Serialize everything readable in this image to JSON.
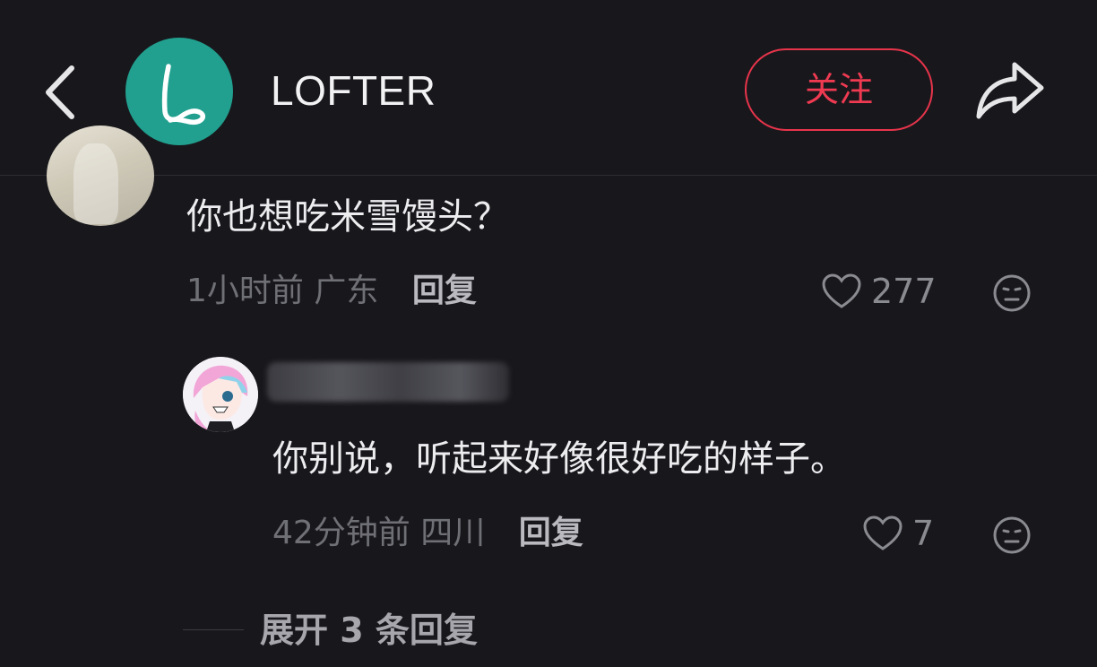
{
  "header": {
    "title": "LOFTER",
    "follow_label": "关注",
    "icons": {
      "back": "chevron-left-icon",
      "logo": "lofter-logo-icon",
      "share": "share-icon"
    },
    "colors": {
      "logo_bg": "#21a08f",
      "follow_accent": "#e8344b"
    }
  },
  "comments": [
    {
      "text": "你也想吃米雪馒头？",
      "time": "1小时前",
      "location": "广东",
      "reply_label": "回复",
      "like_count": "277"
    },
    {
      "text": "你别说，听起来好像很好吃的样子。",
      "time": "42分钟前",
      "location": "四川",
      "reply_label": "回复",
      "like_count": "7"
    }
  ],
  "expand": {
    "label": "展开 3 条回复"
  }
}
